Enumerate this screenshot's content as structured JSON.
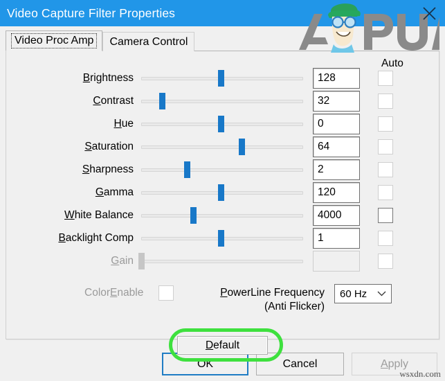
{
  "window": {
    "title": "Video Capture Filter Properties",
    "close_icon": "close-icon",
    "titlebar_color": "#2196e8"
  },
  "brand_watermark": {
    "text": "APPUALS",
    "hat_color": "#2aa05a",
    "letter_color": "#8a8a8a"
  },
  "tabs": [
    {
      "label": "Video Proc Amp",
      "active": true
    },
    {
      "label": "Camera Control",
      "active": false
    }
  ],
  "auto_column_header": "Auto",
  "rows": [
    {
      "label_pre": "",
      "label_key": "B",
      "label_post": "rightness",
      "value": "128",
      "slider_pct": 49,
      "enabled": true,
      "auto_enabled": false
    },
    {
      "label_pre": "",
      "label_key": "C",
      "label_post": "ontrast",
      "value": "32",
      "slider_pct": 13,
      "enabled": true,
      "auto_enabled": false
    },
    {
      "label_pre": "",
      "label_key": "H",
      "label_post": "ue",
      "value": "0",
      "slider_pct": 49,
      "enabled": true,
      "auto_enabled": false
    },
    {
      "label_pre": "",
      "label_key": "S",
      "label_post": "aturation",
      "value": "64",
      "slider_pct": 62,
      "enabled": true,
      "auto_enabled": false
    },
    {
      "label_pre": "",
      "label_key": "S",
      "label_post": "harpness",
      "value": "2",
      "slider_pct": 28,
      "enabled": true,
      "auto_enabled": false
    },
    {
      "label_pre": "",
      "label_key": "G",
      "label_post": "amma",
      "value": "120",
      "slider_pct": 49,
      "enabled": true,
      "auto_enabled": false
    },
    {
      "label_pre": "",
      "label_key": "W",
      "label_post": "hite Balance",
      "value": "4000",
      "slider_pct": 32,
      "enabled": true,
      "auto_enabled": true
    },
    {
      "label_pre": "",
      "label_key": "B",
      "label_post": "acklight Comp",
      "value": "1",
      "slider_pct": 49,
      "enabled": true,
      "auto_enabled": false
    },
    {
      "label_pre": "",
      "label_key": "G",
      "label_post": "ain",
      "value": "",
      "slider_pct": 0,
      "enabled": false,
      "auto_enabled": false
    }
  ],
  "color_enable": {
    "label_pre": "Color",
    "label_key": "E",
    "label_post": "nable",
    "checked": false,
    "enabled": false
  },
  "powerline": {
    "label_key": "P",
    "label_line1_post": "owerLine Frequency",
    "label_line2": "(Anti Flicker)",
    "selected": "60 Hz",
    "arrow_icon": "chevron-down-icon"
  },
  "default_button": {
    "label_key": "D",
    "label_post": "efault",
    "highlight_color": "#3ee03e"
  },
  "footer": {
    "ok": "OK",
    "cancel": "Cancel",
    "apply_key": "A",
    "apply_post": "pply",
    "apply_enabled": false
  },
  "page_watermark": "wsxdn.com"
}
